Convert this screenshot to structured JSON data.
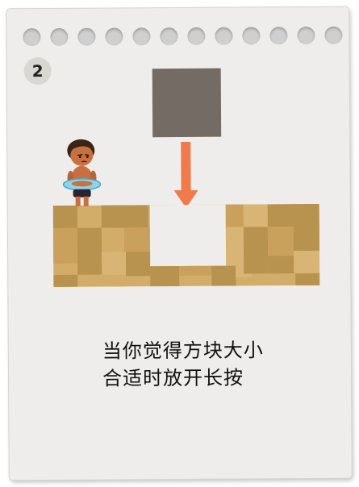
{
  "level": {
    "number": "2"
  },
  "instruction": {
    "line1": "当你觉得方块大小",
    "line2": "合适时放开长按"
  },
  "colors": {
    "card": "#eeedeb",
    "block": "#736b64",
    "arrow": "#f07a4c",
    "ground_light": "#d2ad6a",
    "ground_dark": "#b8924f",
    "text": "#111111"
  },
  "icons": {
    "binder_hole": "circle",
    "arrow": "down-arrow-icon"
  }
}
